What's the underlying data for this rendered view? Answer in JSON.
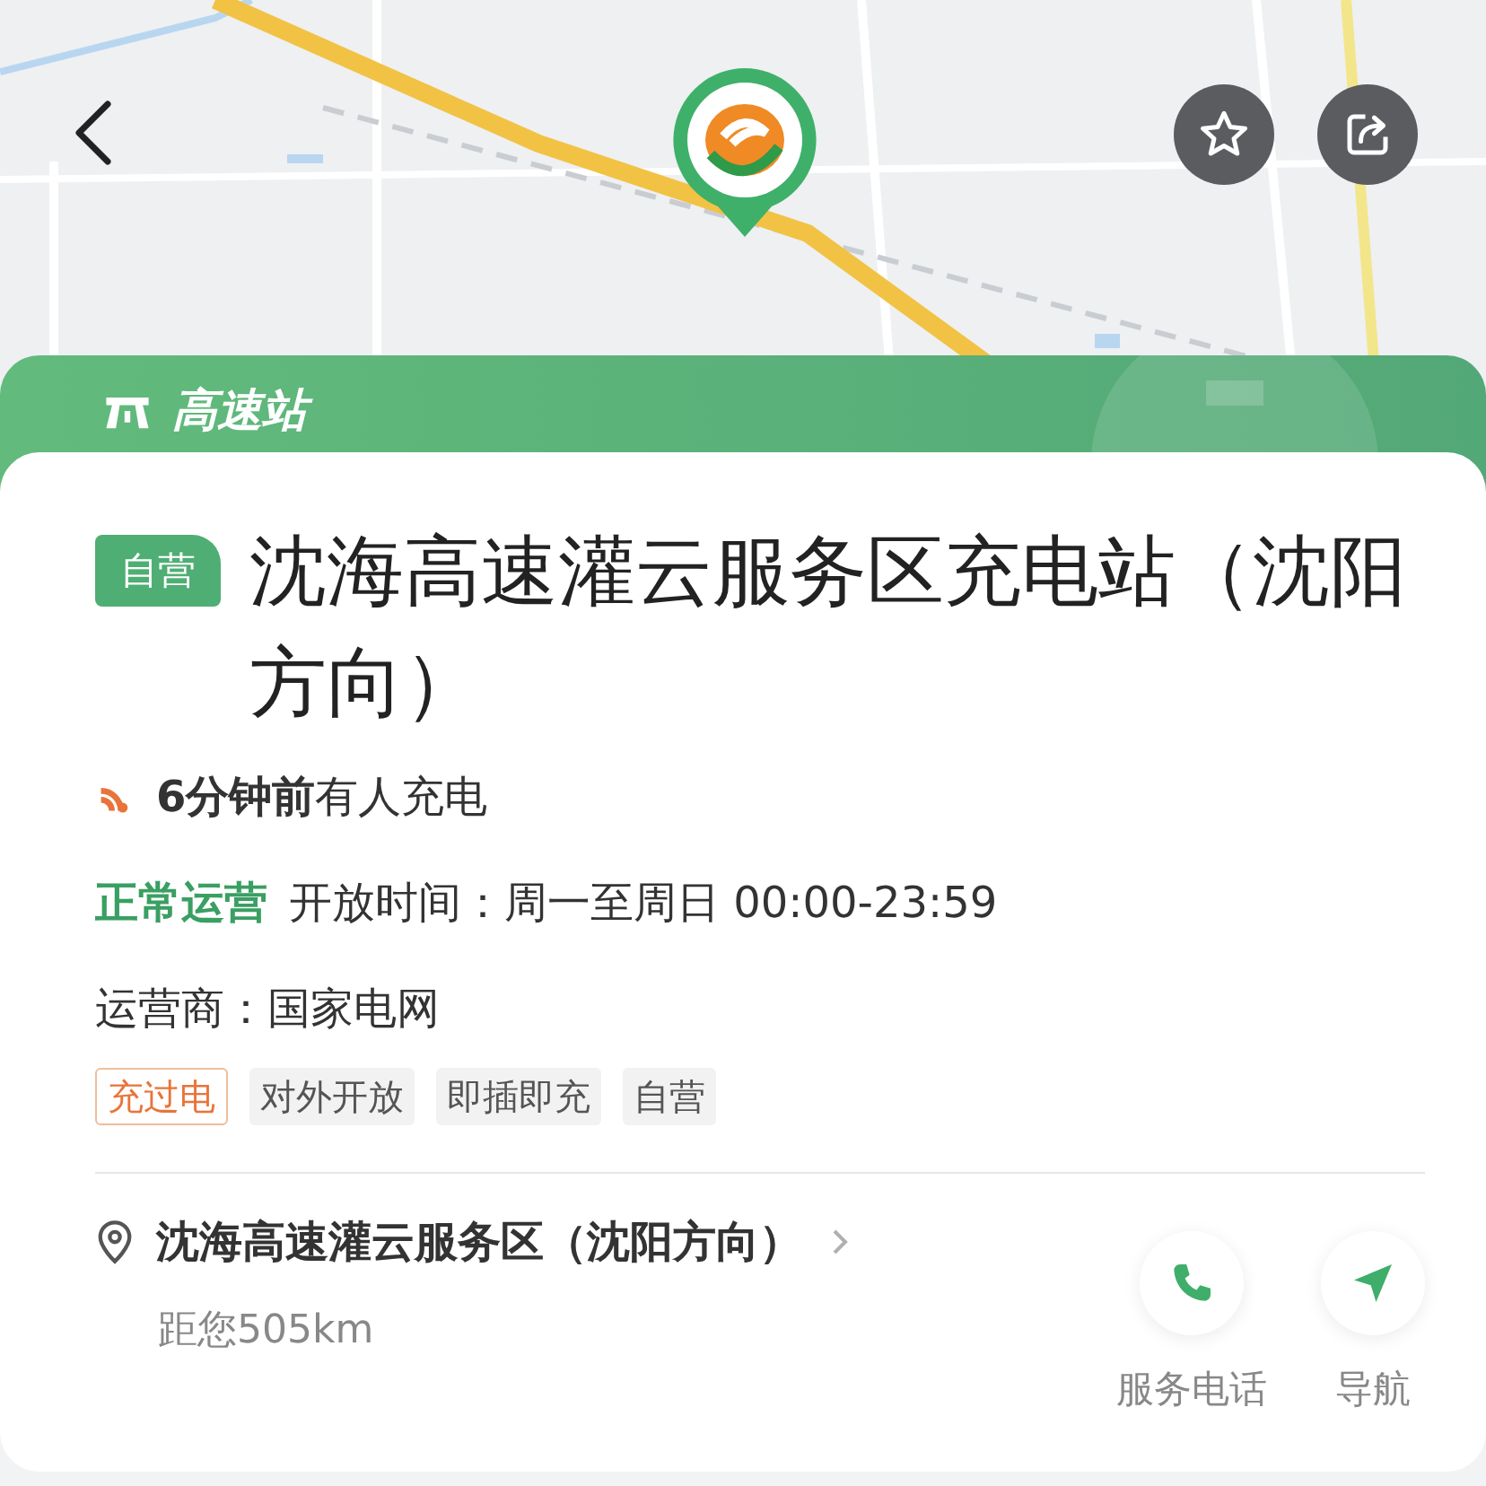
{
  "category": "高速站",
  "station": {
    "badge": "自营",
    "name": "沈海高速灌云服务区充电站（沈阳方向）"
  },
  "activity": "**6分钟前**有人充电",
  "status": "正常运营",
  "hours": "开放时间：周一至周日 00:00-23:59",
  "operator": "运营商：国家电网",
  "tags": [
    {
      "label": "充过电",
      "kind": "highlight"
    },
    {
      "label": "对外开放",
      "kind": "plain"
    },
    {
      "label": "即插即充",
      "kind": "plain"
    },
    {
      "label": "自营",
      "kind": "plain"
    }
  ],
  "location": {
    "name": "沈海高速灌云服务区（沈阳方向）",
    "distance": "距您505km"
  },
  "actions": [
    {
      "label": "服务电话",
      "kind": "phone"
    },
    {
      "label": "导航",
      "kind": "navigate"
    }
  ]
}
